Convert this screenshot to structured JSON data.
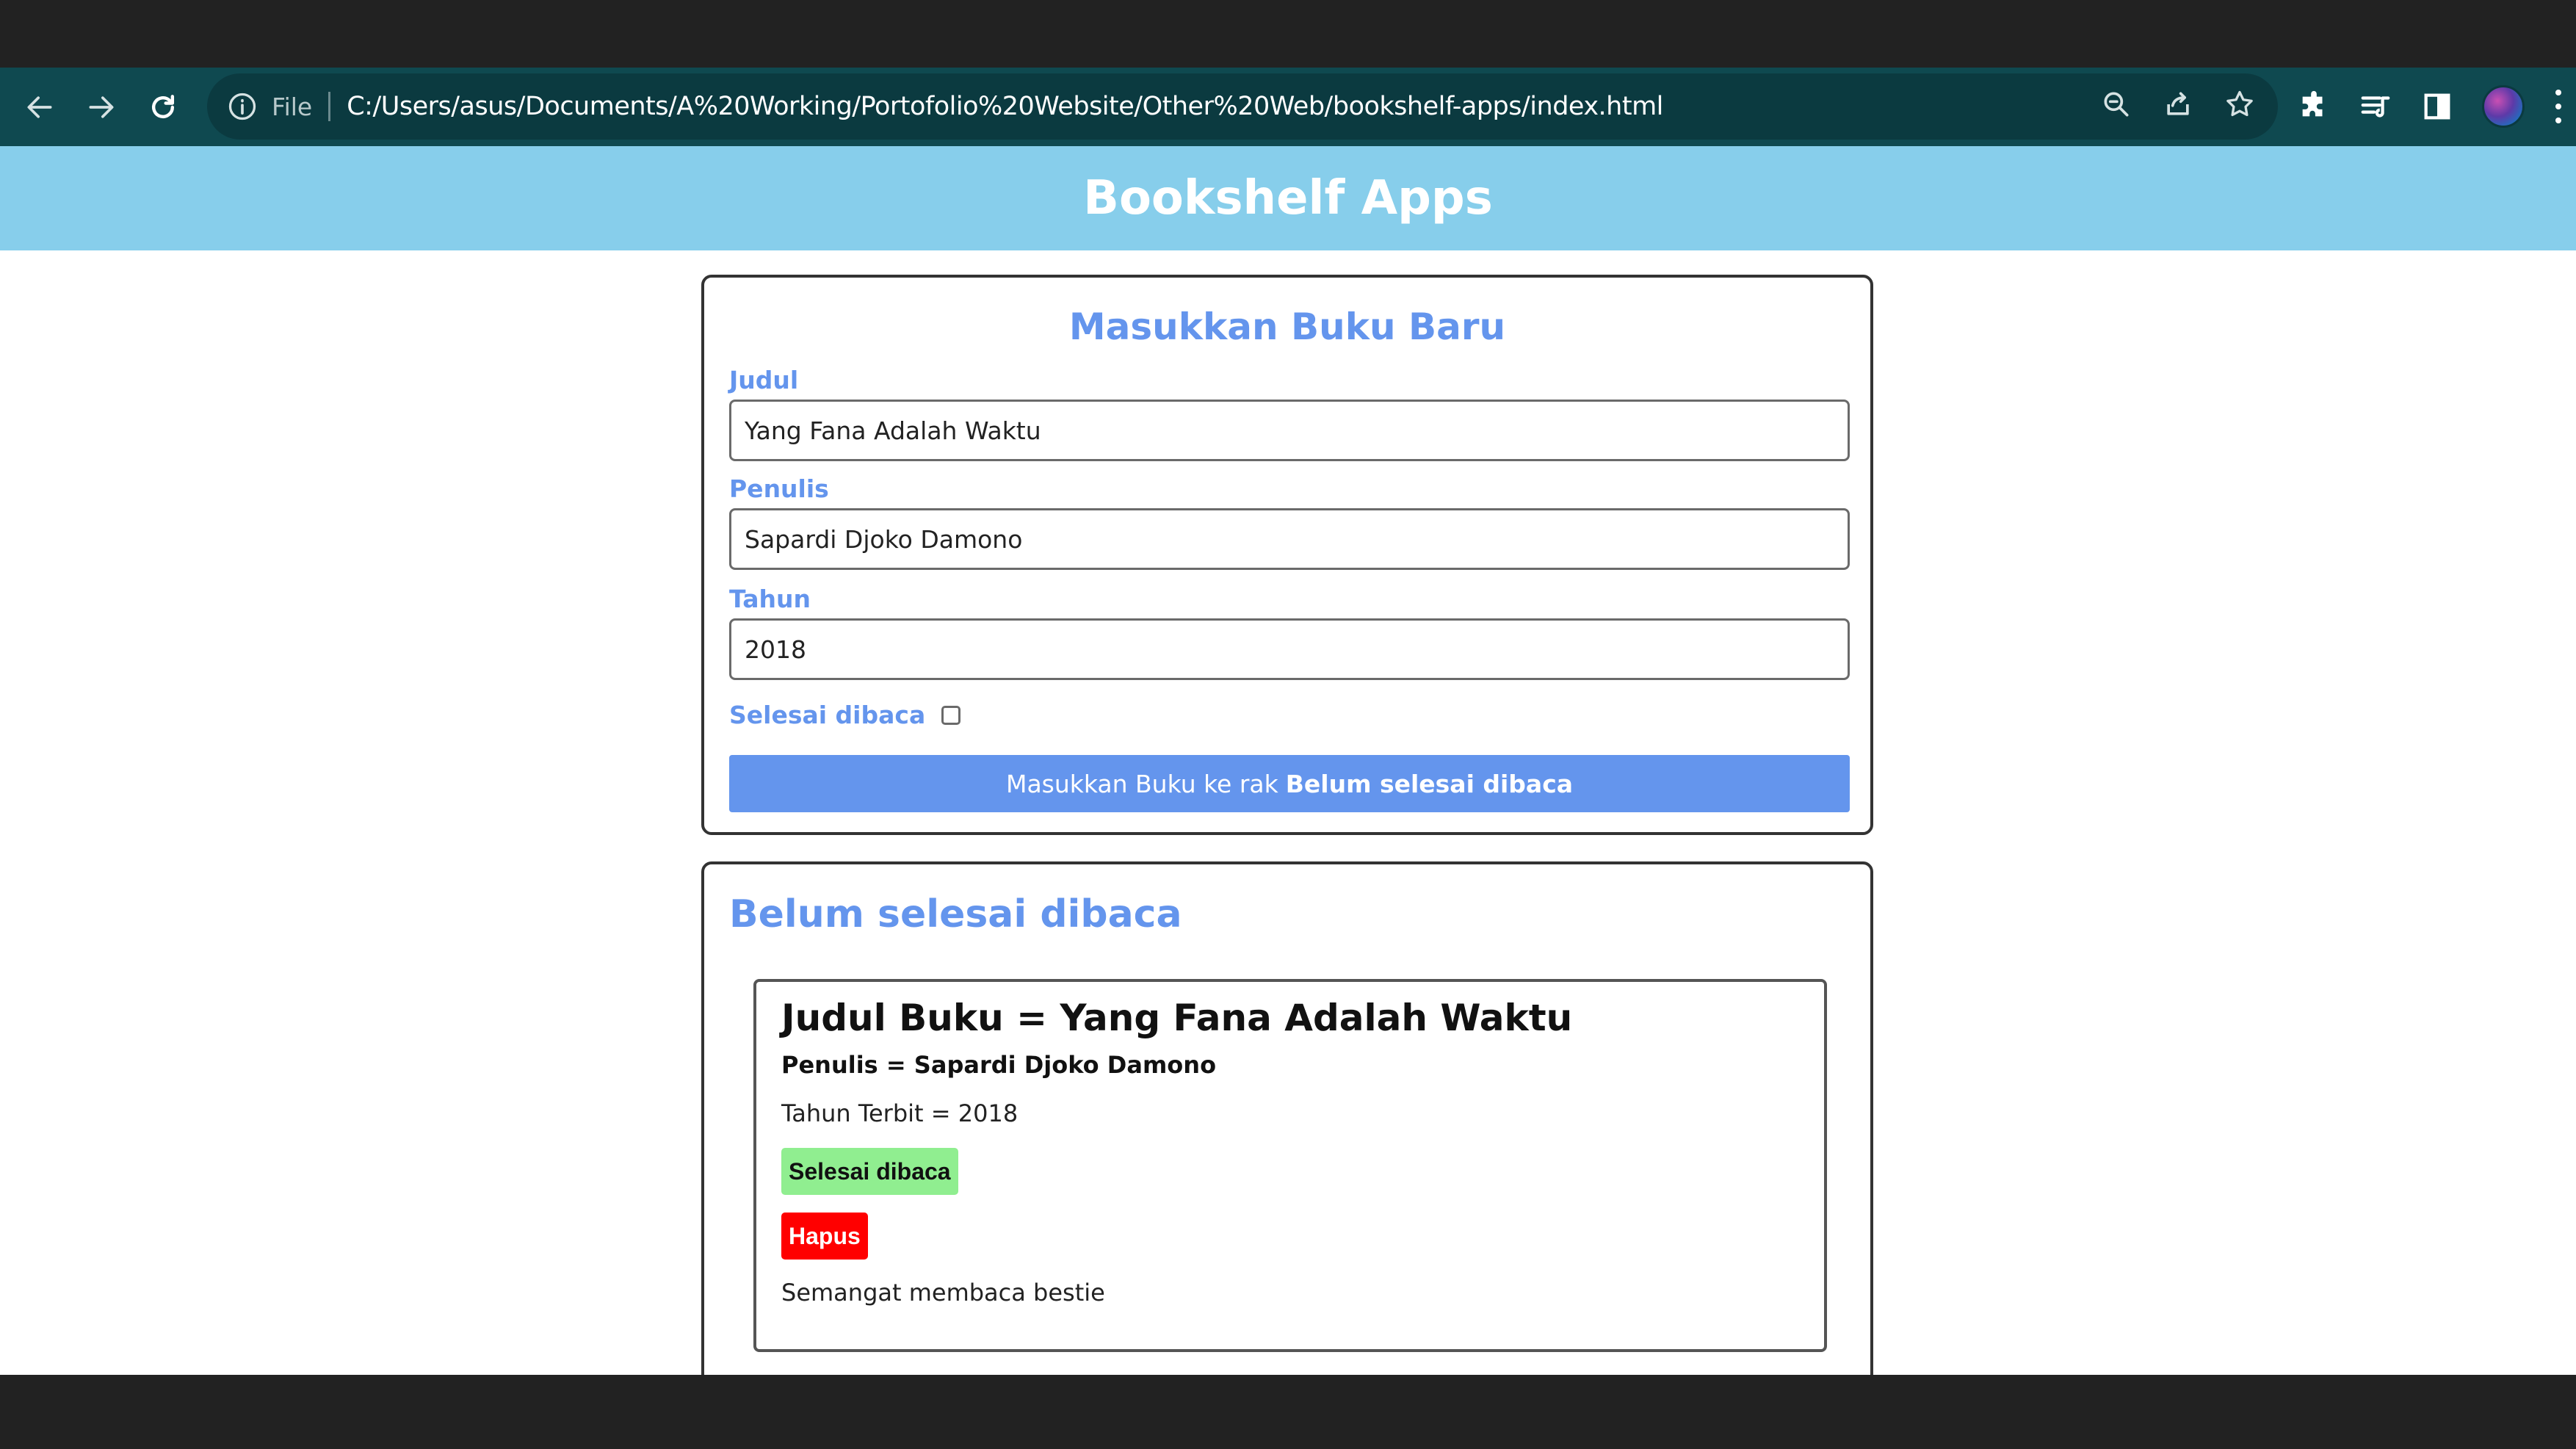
{
  "browser": {
    "file_label": "File",
    "url": "C:/Users/asus/Documents/A%20Working/Portofolio%20Website/Other%20Web/bookshelf-apps/index.html",
    "icons": {
      "back": "arrow-left-icon",
      "forward": "arrow-right-icon",
      "reload": "reload-icon",
      "info": "info-icon",
      "zoom": "zoom-icon",
      "share": "share-icon",
      "bookmark": "star-icon",
      "extensions": "puzzle-icon",
      "media": "media-queue-icon",
      "side_panel": "side-panel-icon",
      "profile": "avatar",
      "menu": "kebab-menu-icon"
    }
  },
  "app": {
    "title": "Bookshelf Apps"
  },
  "form": {
    "heading": "Masukkan Buku Baru",
    "title_label": "Judul",
    "title_value": "Yang Fana Adalah Waktu",
    "author_label": "Penulis",
    "author_value": "Sapardi Djoko Damono",
    "year_label": "Tahun",
    "year_value": "2018",
    "complete_label": "Selesai dibaca",
    "complete_checked": false,
    "submit_prefix": "Masukkan Buku ke rak",
    "submit_shelf": "Belum selesai dibaca"
  },
  "incomplete_shelf": {
    "heading": "Belum selesai dibaca",
    "books": [
      {
        "title": "Judul Buku = Yang Fana Adalah Waktu",
        "author": "Penulis = Sapardi Djoko Damono",
        "year": "Tahun Terbit = 2018",
        "done_button": "Selesai dibaca",
        "delete_button": "Hapus",
        "note": "Semangat membaca bestie"
      }
    ]
  },
  "colors": {
    "toolbar": "#0f4950",
    "header": "#87ceeb",
    "accent": "#6495ed",
    "done": "#90ee90",
    "delete": "#ff0000"
  }
}
